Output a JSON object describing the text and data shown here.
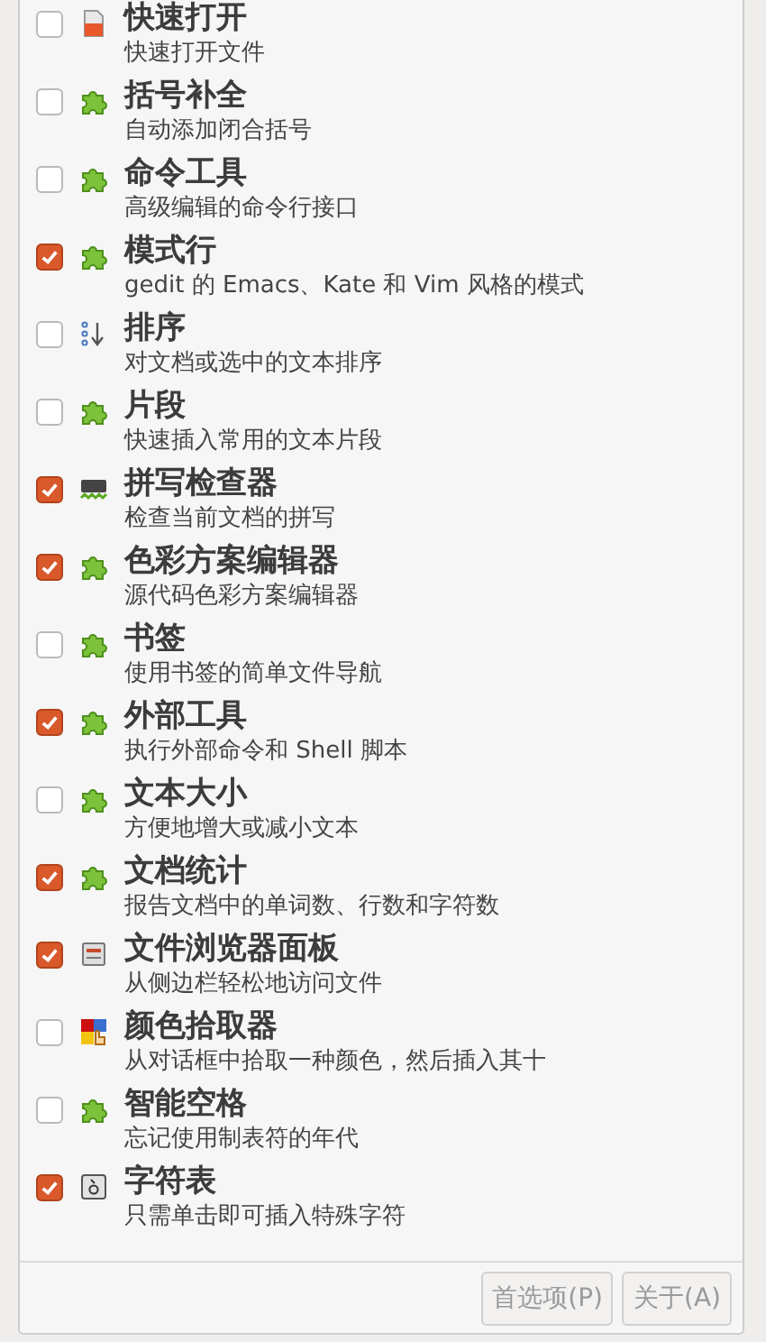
{
  "plugins": [
    {
      "name": "快速打开",
      "description": "快速打开文件",
      "kind": "document",
      "checked": false
    },
    {
      "name": "括号补全",
      "description": "自动添加闭合括号",
      "kind": "puzzle",
      "checked": false
    },
    {
      "name": "命令工具",
      "description": "高级编辑的命令行接口",
      "kind": "puzzle",
      "checked": false
    },
    {
      "name": "模式行",
      "description": "gedit 的 Emacs、Kate 和 Vim 风格的模式",
      "kind": "puzzle",
      "checked": true
    },
    {
      "name": "排序",
      "description": "对文档或选中的文本排序",
      "kind": "sort",
      "checked": false
    },
    {
      "name": "片段",
      "description": "快速插入常用的文本片段",
      "kind": "puzzle",
      "checked": false
    },
    {
      "name": "拼写检查器",
      "description": "检查当前文档的拼写",
      "kind": "spell",
      "checked": true
    },
    {
      "name": "色彩方案编辑器",
      "description": "源代码色彩方案编辑器",
      "kind": "puzzle",
      "checked": true
    },
    {
      "name": "书签",
      "description": "使用书签的简单文件导航",
      "kind": "puzzle",
      "checked": false
    },
    {
      "name": "外部工具",
      "description": "执行外部命令和 Shell 脚本",
      "kind": "puzzle",
      "checked": true
    },
    {
      "name": "文本大小",
      "description": "方便地增大或减小文本",
      "kind": "puzzle",
      "checked": false
    },
    {
      "name": "文档统计",
      "description": "报告文档中的单词数、行数和字符数",
      "kind": "puzzle",
      "checked": true
    },
    {
      "name": "文件浏览器面板",
      "description": "从侧边栏轻松地访问文件",
      "kind": "drawer",
      "checked": true
    },
    {
      "name": "颜色拾取器",
      "description": "从对话框中拾取一种颜色，然后插入其十",
      "kind": "color",
      "checked": false
    },
    {
      "name": "智能空格",
      "description": "忘记使用制表符的年代",
      "kind": "puzzle",
      "checked": false
    },
    {
      "name": "字符表",
      "description": "只需单击即可插入特殊字符",
      "kind": "charmap",
      "checked": true
    }
  ],
  "buttons": [
    {
      "label": "首选项(P)",
      "disabled": true
    },
    {
      "label": "关于(A)",
      "disabled": true
    }
  ]
}
